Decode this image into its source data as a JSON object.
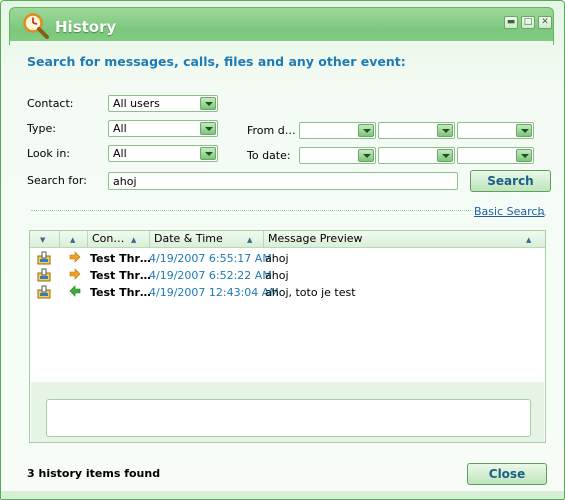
{
  "window": {
    "title": "History",
    "controls": [
      "minimize",
      "maximize",
      "close"
    ]
  },
  "heading": "Search for messages, calls, files and any other event:",
  "form": {
    "contact_label": "Contact:",
    "contact_value": "All users",
    "type_label": "Type:",
    "type_value": "All",
    "lookin_label": "Look in:",
    "lookin_value": "All",
    "from_label": "From d…",
    "to_label": "To date:",
    "search_label": "Search for:",
    "search_value": "ahoj",
    "search_button": "Search",
    "basic_search_link": "Basic Search"
  },
  "list": {
    "columns": [
      "Con…",
      "Date & Time",
      "Message Preview"
    ],
    "rows": [
      {
        "direction": "outgoing",
        "contact": "Test Thr…",
        "datetime": "4/19/2007 6:55:17 AM",
        "preview": "ahoj"
      },
      {
        "direction": "outgoing",
        "contact": "Test Thr…",
        "datetime": "4/19/2007 6:52:22 AM",
        "preview": "ahoj"
      },
      {
        "direction": "incoming",
        "contact": "Test Thr…",
        "datetime": "4/19/2007 12:43:04 AM",
        "preview": "ahoj, toto je test"
      }
    ]
  },
  "status": "3 history items found",
  "close_button": "Close",
  "colors": {
    "accent_green": "#7cc77c",
    "heading_blue": "#1e7bb5",
    "outgoing_arrow": "#f0a020",
    "incoming_arrow": "#3cae3c"
  }
}
